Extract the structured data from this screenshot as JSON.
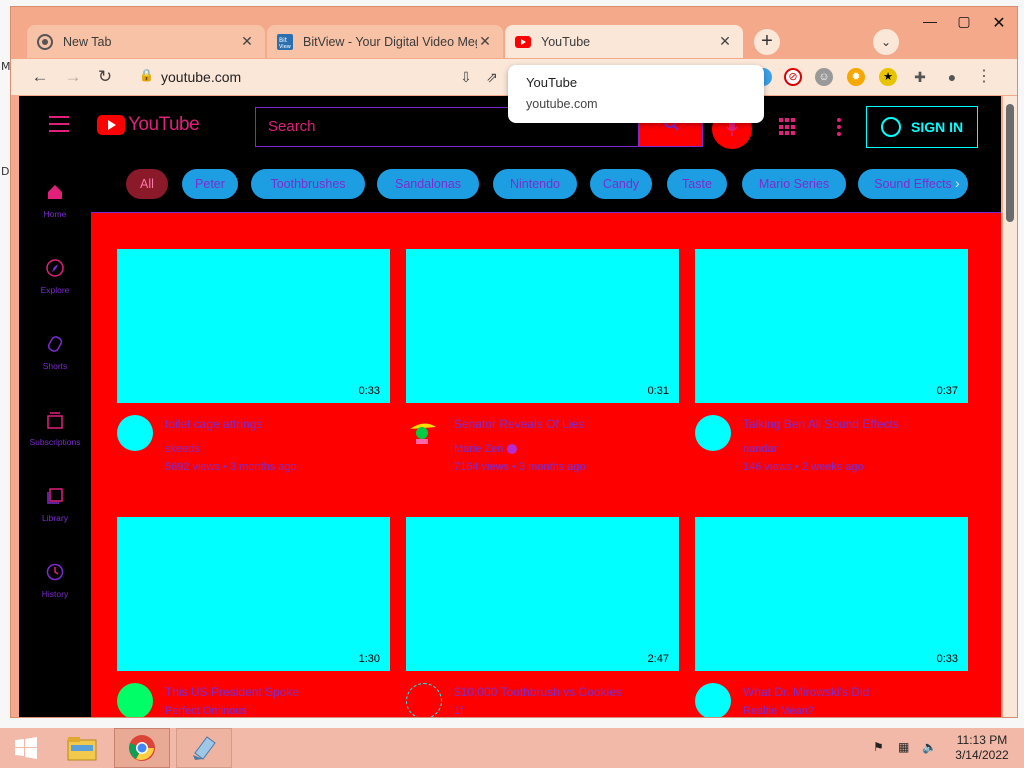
{
  "browser": {
    "tabs": [
      {
        "title": "New Tab",
        "icon": "chrome-icon"
      },
      {
        "title": "BitView - Your Digital Video Meg",
        "icon": "bitview-icon"
      },
      {
        "title": "YouTube",
        "icon": "youtube-icon",
        "active": true
      }
    ],
    "url": "youtube.com",
    "popup": {
      "title": "YouTube",
      "domain": "youtube.com"
    }
  },
  "youtube": {
    "logo_text": "YouTube",
    "search_placeholder": "Search",
    "sign_in": "SIGN IN",
    "sidebar": [
      {
        "label": "Home",
        "icon": "home-icon"
      },
      {
        "label": "Explore",
        "icon": "explore-icon"
      },
      {
        "label": "Shorts",
        "icon": "shorts-icon"
      },
      {
        "label": "Subscriptions",
        "icon": "subscriptions-icon"
      },
      {
        "label": "Library",
        "icon": "library-icon"
      },
      {
        "label": "History",
        "icon": "history-icon"
      }
    ],
    "chips": [
      "All",
      "Peter",
      "Toothbrushes",
      "Sandalonas",
      "Nintendo",
      "Candy",
      "Taste",
      "Mario Series",
      "Sound Effects"
    ],
    "videos": [
      {
        "title": "toilet cage attrings",
        "channel": "skeeds",
        "stats": "5692 views • 3 months ago",
        "duration": "0:33"
      },
      {
        "title": "Senator Reveals Of Lies",
        "channel": "Marie Zen",
        "stats": "7164 views • 3 months ago",
        "duration": "0:31"
      },
      {
        "title": "Talking Ben All Sound Effects",
        "channel": "nandar",
        "stats": "146 views • 2 weeks ago",
        "duration": "0:37"
      },
      {
        "title": "This US President Spoke",
        "channel": "Perfect Ominous",
        "stats": "",
        "duration": "1:30"
      },
      {
        "title": "$10,000 Toothbrush vs Cookies",
        "channel": "1f",
        "stats": "",
        "duration": "2:47"
      },
      {
        "title": "What Dr. Mirowski's Did",
        "channel": "Realtie Mean?",
        "stats": "",
        "duration": "0:33"
      }
    ]
  },
  "taskbar": {
    "time": "11:13 PM",
    "date": "3/14/2022"
  },
  "colors": {
    "page_bg": "#ff0000",
    "thumb": "#00ffff",
    "text_accent": "#7d2bd1",
    "chip": "#1e9ee2",
    "browser_frame": "#f4a98a"
  }
}
